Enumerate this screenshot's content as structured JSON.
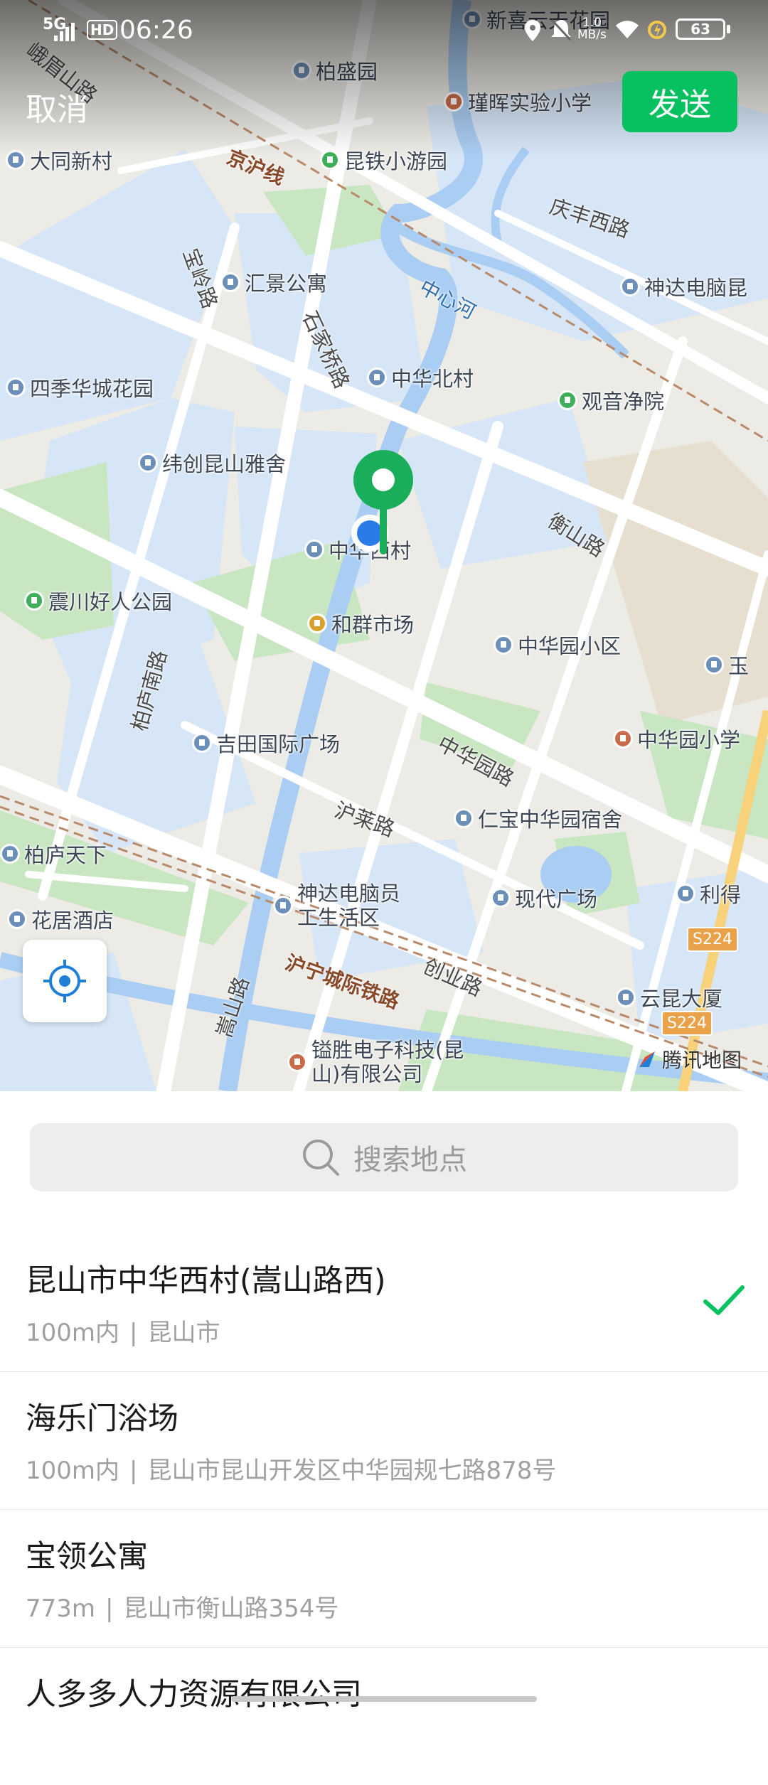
{
  "status_bar": {
    "network": "5G",
    "hd": "HD",
    "time": "06:26",
    "speed_value": "1.0",
    "speed_unit": "MB/s",
    "battery": "63"
  },
  "header": {
    "cancel_label": "取消",
    "send_label": "发送"
  },
  "map": {
    "pois": [
      {
        "name": "新喜云天花园",
        "color": "#6b8fb8"
      },
      {
        "name": "柏盛园",
        "color": "#6b8fb8"
      },
      {
        "name": "瑾晖实验小学",
        "color": "#c96a4a"
      },
      {
        "name": "大同新村",
        "color": "#6b8fb8"
      },
      {
        "name": "昆铁小游园",
        "color": "#3fae5a"
      },
      {
        "name": "汇景公寓",
        "color": "#6b8fb8"
      },
      {
        "name": "神达电脑昆",
        "color": "#6b8fb8"
      },
      {
        "name": "四季华城花园",
        "color": "#6b8fb8"
      },
      {
        "name": "中华北村",
        "color": "#6b8fb8"
      },
      {
        "name": "观音净院",
        "color": "#3fae5a"
      },
      {
        "name": "纬创昆山雅舍",
        "color": "#6b8fb8"
      },
      {
        "name": "中华西村",
        "color": "#6b8fb8"
      },
      {
        "name": "震川好人公园",
        "color": "#3fae5a"
      },
      {
        "name": "和群市场",
        "color": "#d8a12b"
      },
      {
        "name": "中华园小区",
        "color": "#6b8fb8"
      },
      {
        "name": "玉",
        "color": "#6b8fb8"
      },
      {
        "name": "吉田国际广场",
        "color": "#6b8fb8"
      },
      {
        "name": "中华园小学",
        "color": "#c96a4a"
      },
      {
        "name": "仁宝中华园宿舍",
        "color": "#6b8fb8"
      },
      {
        "name": "柏庐天下",
        "color": "#6b8fb8"
      },
      {
        "name": "现代广场",
        "color": "#6b8fb8"
      },
      {
        "name": "利得",
        "color": "#6b8fb8"
      },
      {
        "name": "花居酒店",
        "color": "#6b8fb8"
      },
      {
        "name": "神达电脑员工生活区",
        "color": "#6b8fb8"
      },
      {
        "name": "云昆大厦",
        "color": "#6b8fb8"
      },
      {
        "name": "镒胜电子科技(昆山)有限公司",
        "color": "#c96a4a"
      }
    ],
    "roads": [
      "峨眉山路",
      "京沪线",
      "庆丰西路",
      "宝岭路",
      "石家桥路",
      "衡山路",
      "柏庐南路",
      "中华园路",
      "沪莱路",
      "创业路",
      "嵩山路",
      "沪宁城际铁路"
    ],
    "river": "中心河",
    "shields": [
      "S224",
      "S224"
    ],
    "attribution": "腾讯地图"
  },
  "search": {
    "placeholder": "搜索地点"
  },
  "results": [
    {
      "title": "昆山市中华西村(嵩山路西)",
      "distance": "100m内",
      "address": "昆山市",
      "selected": true
    },
    {
      "title": "海乐门浴场",
      "distance": "100m内",
      "address": "昆山市昆山开发区中华园规七路878号",
      "selected": false
    },
    {
      "title": "宝领公寓",
      "distance": "773m",
      "address": "昆山市衡山路354号",
      "selected": false
    },
    {
      "title": "人多多人力资源有限公司",
      "distance": "",
      "address": "",
      "selected": false
    }
  ],
  "colors": {
    "accent": "#07c160",
    "pin": "#1aad5a",
    "water": "#d6e6f7",
    "park": "#c9e6c2"
  }
}
